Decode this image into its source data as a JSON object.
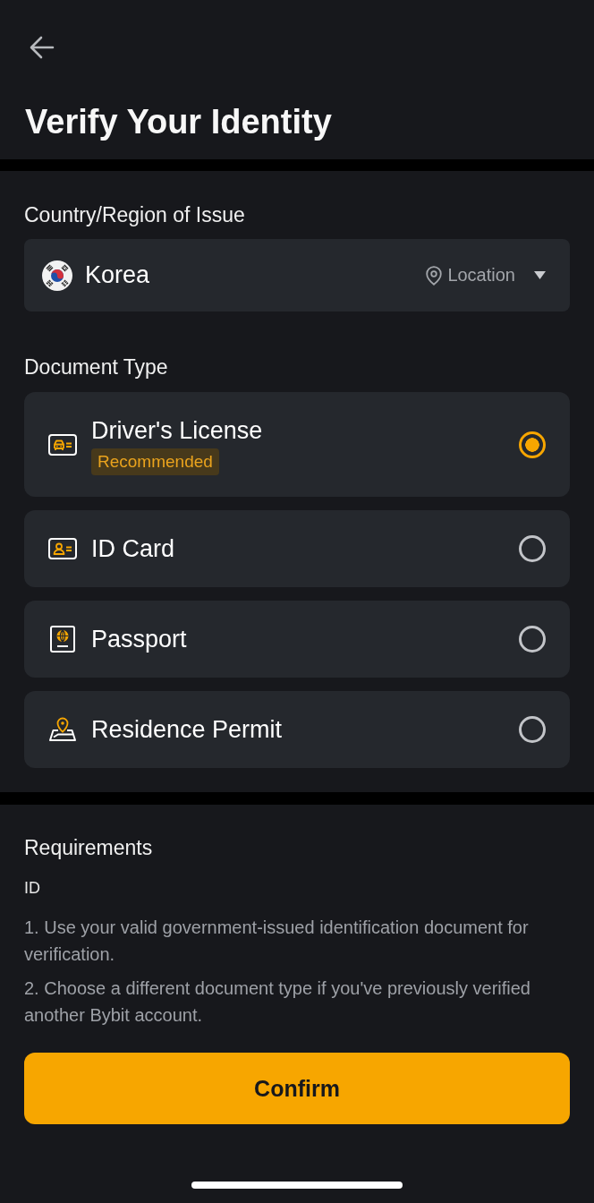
{
  "header": {
    "title": "Verify Your Identity"
  },
  "country": {
    "label": "Country/Region of Issue",
    "value": "Korea",
    "location_label": "Location"
  },
  "document_type": {
    "label": "Document Type",
    "options": [
      {
        "kind": "license",
        "name": "Driver's License",
        "badge": "Recommended",
        "selected": true
      },
      {
        "kind": "id_card",
        "name": "ID Card",
        "selected": false
      },
      {
        "kind": "passport",
        "name": "Passport",
        "selected": false
      },
      {
        "kind": "residence",
        "name": "Residence Permit",
        "selected": false
      }
    ]
  },
  "requirements": {
    "title": "Requirements",
    "subtitle": "ID",
    "items": [
      "1. Use your valid government-issued identification document for verification.",
      "2. Choose a different document type if you've previously verified another Bybit account."
    ]
  },
  "confirm_button": "Confirm"
}
